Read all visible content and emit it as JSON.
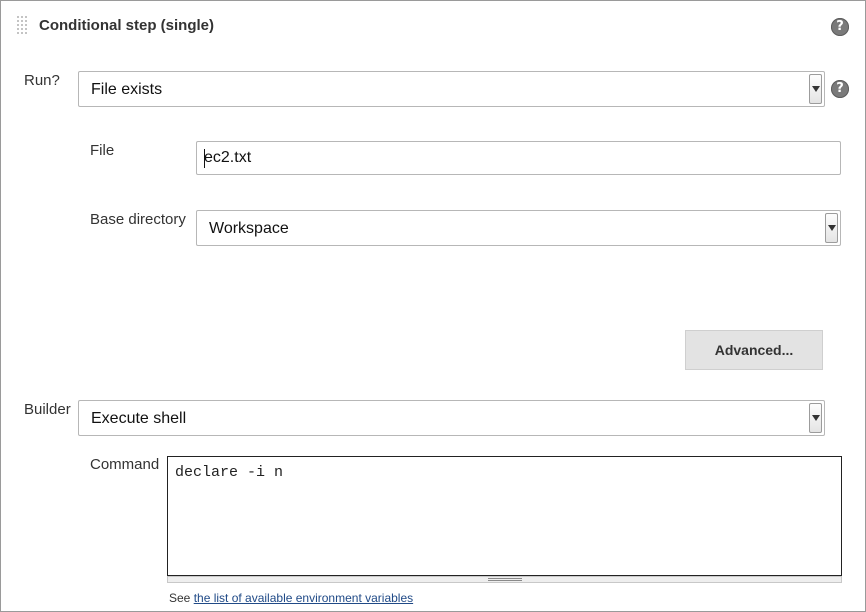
{
  "panel": {
    "title": "Conditional step (single)",
    "help_icon": "question-mark-icon"
  },
  "run": {
    "label": "Run?",
    "selected": "File exists",
    "help_icon": "question-mark-icon"
  },
  "file": {
    "label": "File",
    "value": "ec2.txt"
  },
  "base_directory": {
    "label": "Base directory",
    "selected": "Workspace"
  },
  "advanced_button": {
    "label": "Advanced..."
  },
  "builder": {
    "label": "Builder",
    "selected": "Execute shell"
  },
  "command": {
    "label": "Command",
    "value": "declare -i n"
  },
  "footnote": {
    "prefix": "See ",
    "link_text": "the list of available environment variables"
  }
}
